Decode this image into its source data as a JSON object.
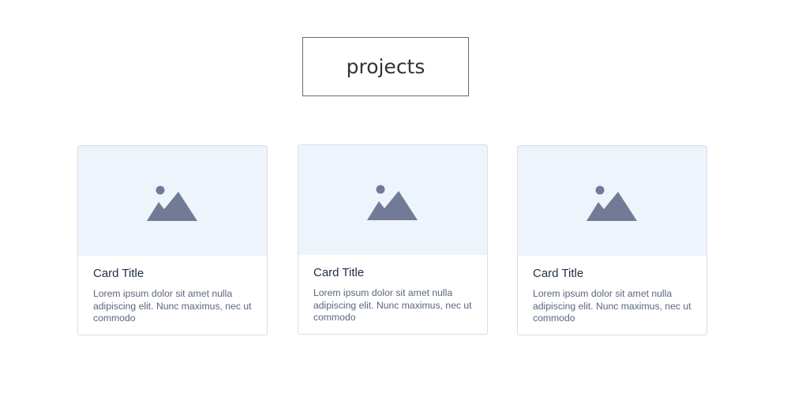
{
  "heading": "projects",
  "cards": [
    {
      "image_icon": "image-placeholder-icon",
      "title": "Card Title",
      "text": "Lorem ipsum dolor sit amet nulla adipiscing elit. Nunc maximus, nec ut commodo"
    },
    {
      "image_icon": "image-placeholder-icon",
      "title": "Card Title",
      "text": "Lorem ipsum dolor sit amet nulla adipiscing elit. Nunc maximus, nec ut commodo"
    },
    {
      "image_icon": "image-placeholder-icon",
      "title": "Card Title",
      "text": "Lorem ipsum dolor sit amet nulla adipiscing elit. Nunc maximus, nec ut commodo"
    }
  ],
  "colors": {
    "image_background": "#eef4fb",
    "icon": "#727b96",
    "card_border": "#dadde3",
    "title": "#1f2d45",
    "text": "#5a6580"
  }
}
